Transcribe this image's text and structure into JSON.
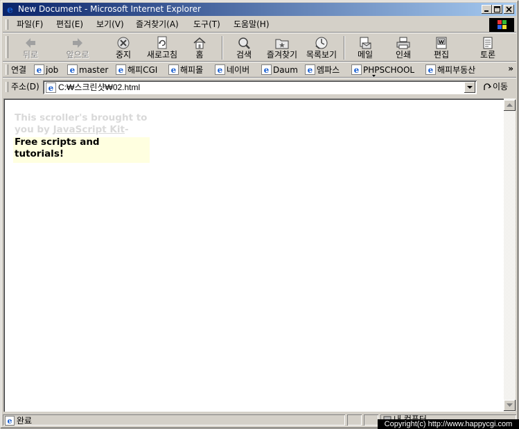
{
  "window": {
    "title": "New Document - Microsoft Internet Explorer"
  },
  "menubar": {
    "items": [
      "파일(F)",
      "편집(E)",
      "보기(V)",
      "즐겨찾기(A)",
      "도구(T)",
      "도움말(H)"
    ]
  },
  "toolbar": {
    "back": "뒤로",
    "forward": "앞으로",
    "stop": "중지",
    "refresh": "새로고침",
    "home": "홈",
    "search": "검색",
    "favorites": "즐겨찾기",
    "history": "목록보기",
    "mail": "메일",
    "print": "인쇄",
    "edit": "편집",
    "discuss": "토론"
  },
  "links": {
    "label": "연결",
    "items": [
      "job",
      "master",
      "해피CGI",
      "해피몰",
      "네이버",
      "Daum",
      "엠파스",
      "PHPSCHOOL",
      "해피부동산"
    ],
    "more": "»"
  },
  "address": {
    "label": "주소(D)",
    "value": "C:₩스크린샷₩02.html",
    "go": "이동"
  },
  "page": {
    "scroller_prev_text": "This scroller's brought to you by",
    "scroller_prev_link": "JavaScript Kit",
    "scroller_prev_tail": "-",
    "scroller_current": "Free scripts and tutorials!"
  },
  "status": {
    "text": "완료",
    "zone": "내 컴퓨터"
  },
  "overlay": {
    "copyright": "Copyright(c) http://www.happycgi.com"
  },
  "colors": {
    "titlebar_start": "#0a246a",
    "titlebar_end": "#a6caf0",
    "chrome": "#d4d0c8",
    "scroller_bg": "#ffffe0"
  }
}
